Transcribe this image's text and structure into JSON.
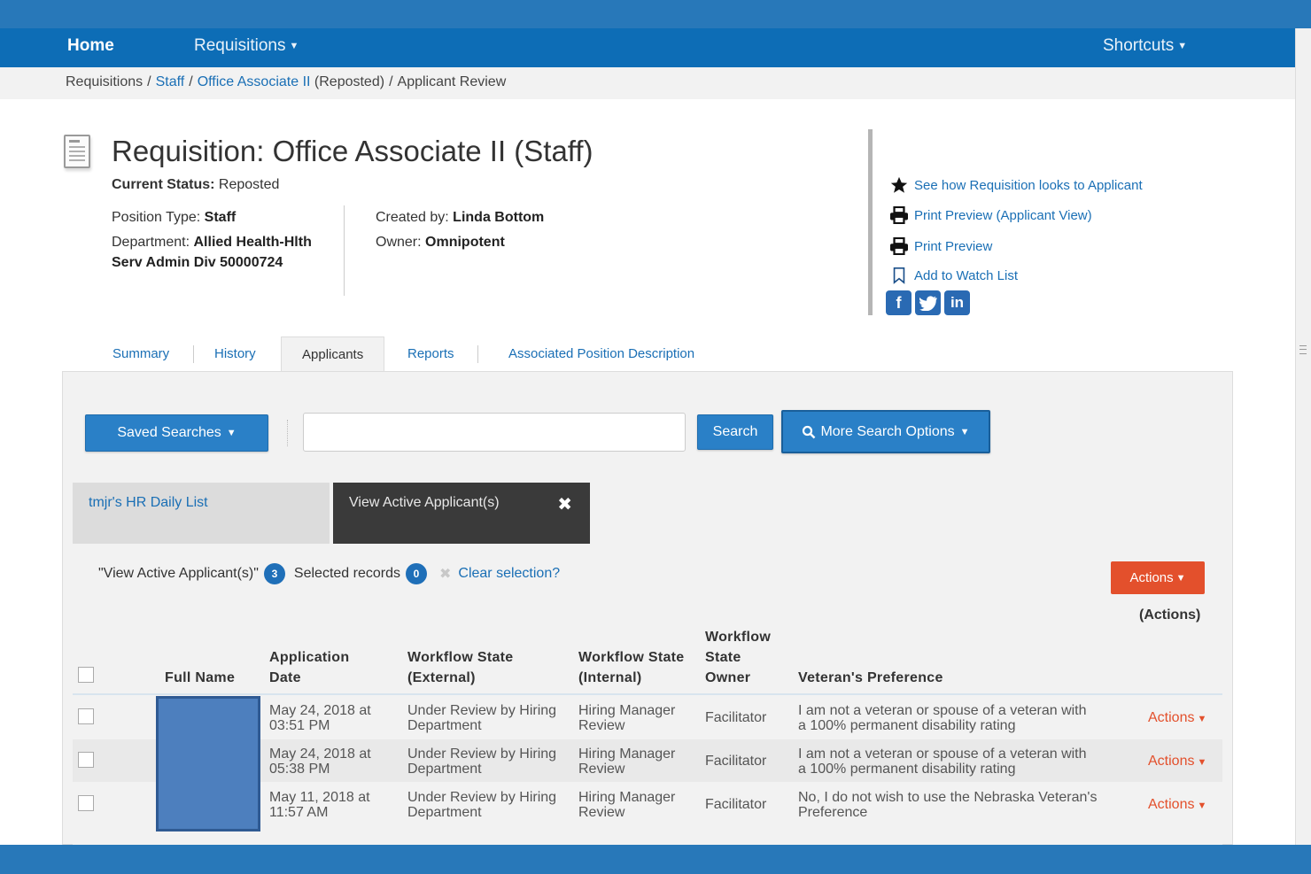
{
  "nav": {
    "home": "Home",
    "requisitions": "Requisitions",
    "shortcuts": "Shortcuts"
  },
  "breadcrumb": {
    "root": "Requisitions",
    "staff": "Staff",
    "position": "Office Associate II",
    "position_suffix": "(Reposted)",
    "current": "Applicant Review"
  },
  "requisition": {
    "title": "Requisition: Office Associate II (Staff)",
    "status_label": "Current Status:",
    "status_value": "Reposted",
    "position_type_label": "Position Type:",
    "position_type_value": "Staff",
    "department_label": "Department:",
    "department_value": "Allied Health-Hlth Serv Admin Div 50000724",
    "created_by_label": "Created by:",
    "created_by_value": "Linda Bottom",
    "owner_label": "Owner:",
    "owner_value": "Omnipotent"
  },
  "side_links": {
    "see_how": "See how Requisition looks to Applicant",
    "print_preview_applicant": "Print Preview (Applicant View)",
    "print_preview": "Print Preview",
    "watch_list": "Add to Watch List"
  },
  "tabs": [
    "Summary",
    "History",
    "Applicants",
    "Reports",
    "Associated Position Description"
  ],
  "search": {
    "saved_searches": "Saved Searches",
    "input_value": "",
    "search_button": "Search",
    "more_options": "More Search Options"
  },
  "list_tabs": {
    "first": "tmjr's HR Daily List",
    "second": "View Active Applicant(s)"
  },
  "results": {
    "view_label": "\"View Active Applicant(s)\"",
    "view_count": "3",
    "selected_label": "Selected records",
    "selected_count": "0",
    "clear_selection": "Clear selection?",
    "actions_button": "Actions",
    "actions_header": "(Actions)"
  },
  "table": {
    "headers": {
      "full_name": "Full Name",
      "app_date_1": "Application",
      "app_date_2": "Date",
      "wf_ext_1": "Workflow State",
      "wf_ext_2": "(External)",
      "wf_int_1": "Workflow State",
      "wf_int_2": "(Internal)",
      "wf_owner_1": "Workflow",
      "wf_owner_2": "State",
      "wf_owner_3": "Owner",
      "veteran": "Veteran's Preference"
    },
    "rows": [
      {
        "date_1": "May 24, 2018 at",
        "date_2": "03:51 PM",
        "ext_1": "Under Review by Hiring",
        "ext_2": "Department",
        "int_1": "Hiring Manager",
        "int_2": "Review",
        "owner": "Facilitator",
        "vet_1": "I am not a veteran or spouse of a veteran with",
        "vet_2": "a 100% permanent disability rating",
        "actions": "Actions"
      },
      {
        "date_1": "May 24, 2018 at",
        "date_2": "05:38 PM",
        "ext_1": "Under Review by Hiring",
        "ext_2": "Department",
        "int_1": "Hiring Manager",
        "int_2": "Review",
        "owner": "Facilitator",
        "vet_1": "I am not a veteran or spouse of a veteran with",
        "vet_2": "a 100% permanent disability rating",
        "actions": "Actions"
      },
      {
        "date_1": "May 11, 2018 at",
        "date_2": "11:57 AM",
        "ext_1": "Under Review by Hiring",
        "ext_2": "Department",
        "int_1": "Hiring Manager",
        "int_2": "Review",
        "owner": "Facilitator",
        "vet_1": "No, I do not wish to use the Nebraska Veteran's",
        "vet_2": "Preference",
        "actions": "Actions"
      }
    ]
  },
  "colors": {
    "nav_blue": "#0d6db6",
    "link_blue": "#1a6fb5",
    "action_orange": "#e3502c",
    "redacted_block": "#4d7fbe"
  }
}
